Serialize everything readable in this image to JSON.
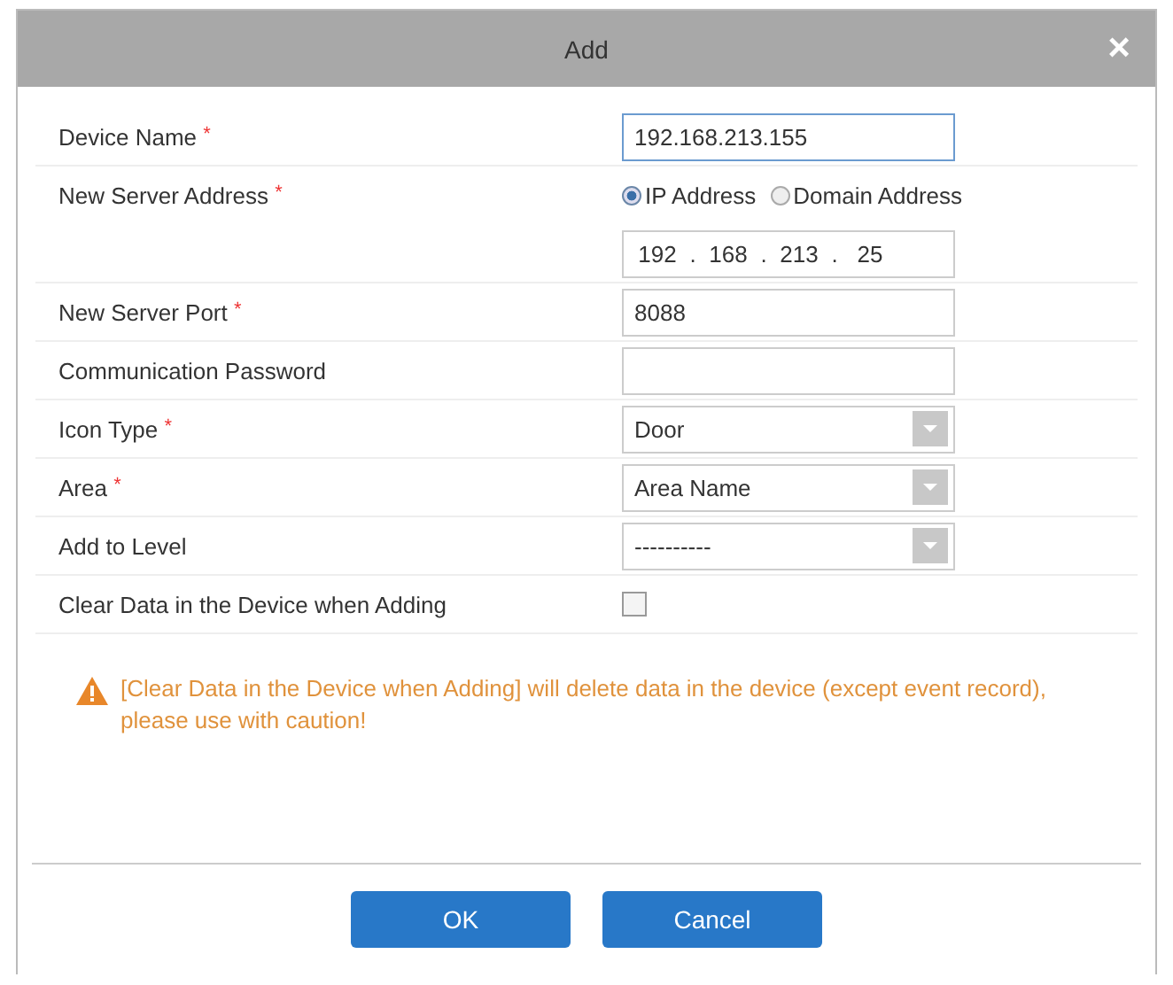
{
  "window": {
    "title": "Add",
    "close": "×"
  },
  "rows": [
    {
      "kind": "text",
      "label": "Device Name",
      "asterisk": "*",
      "value": "192.168.213.155",
      "focused": true
    },
    {
      "kind": "radio",
      "label": "New Server Address",
      "asterisk": "*",
      "options": [
        {
          "label": "IP Address",
          "selected": true
        },
        {
          "label": "Domain Address",
          "selected": false
        }
      ]
    },
    {
      "kind": "ip",
      "parts": [
        "192",
        ".",
        "168",
        ".",
        "213",
        ".",
        "25"
      ]
    },
    {
      "kind": "text",
      "label": "New Server Port",
      "asterisk": "*",
      "value": "8088",
      "focused": false
    },
    {
      "kind": "text",
      "label": "Communication Password",
      "focused": false
    },
    {
      "kind": "select",
      "label": "Icon Type",
      "asterisk": "*",
      "value": "Door"
    },
    {
      "kind": "select",
      "label": "Area",
      "asterisk": "*",
      "value": "Area Name"
    },
    {
      "kind": "select",
      "label": "Add to Level",
      "value": "----------"
    },
    {
      "kind": "checkbox",
      "label": "Clear Data in the Device when Adding",
      "checked": false
    }
  ],
  "warning": "[Clear Data in the Device when Adding] will delete data in the device (except event record), please use with caution!",
  "buttons": [
    "OK",
    "Cancel"
  ]
}
